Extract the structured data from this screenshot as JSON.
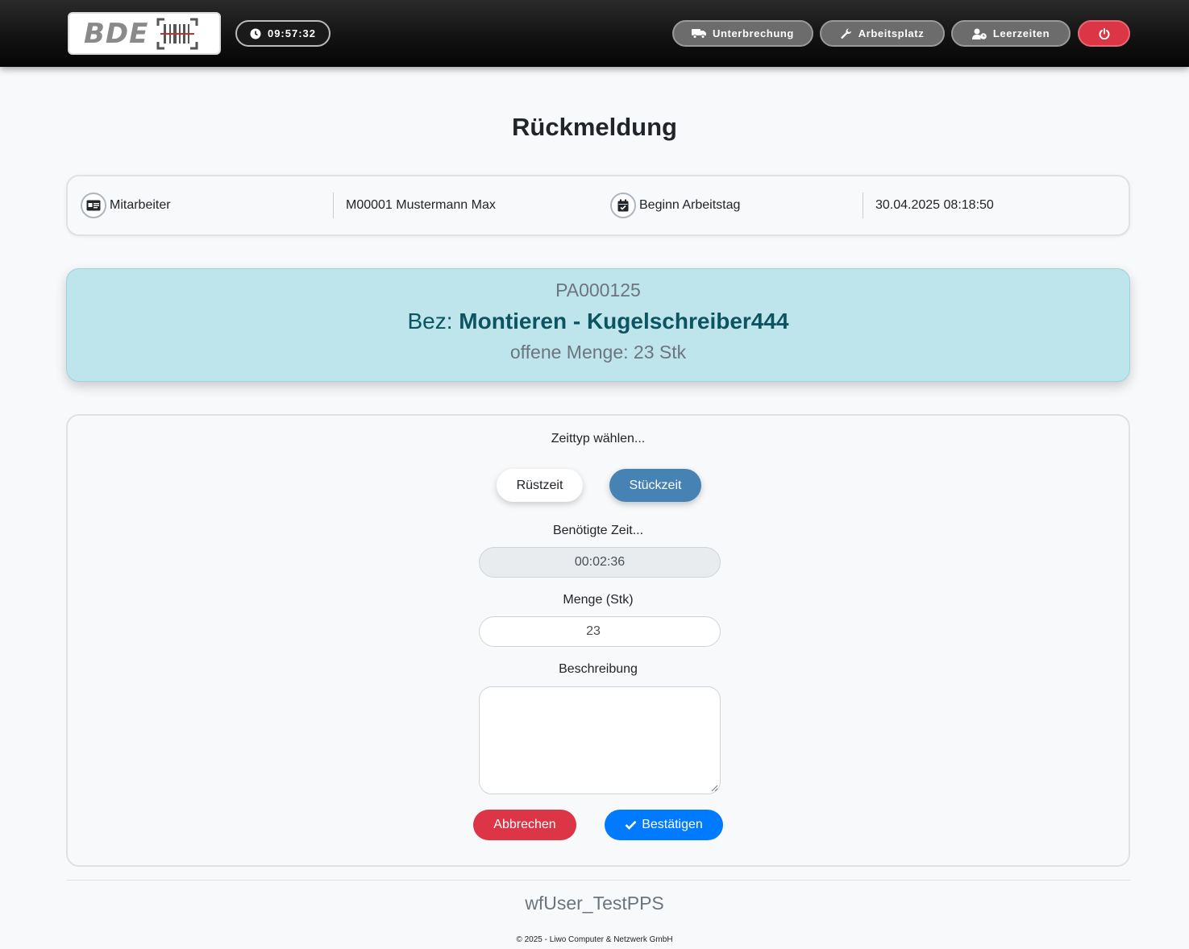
{
  "header": {
    "logo_text": "BDE",
    "clock": "09:57:32",
    "buttons": {
      "interruption": "Unterbrechung",
      "workplace": "Arbeitsplatz",
      "idle_times": "Leerzeiten"
    }
  },
  "page": {
    "title": "Rückmeldung"
  },
  "info": {
    "employee_label": "Mitarbeiter",
    "employee_value": "M00001 Mustermann Max",
    "workday_label": "Beginn Arbeitstag",
    "workday_value": "30.04.2025 08:18:50"
  },
  "order": {
    "number": "PA000125",
    "bez_prefix": "Bez:",
    "bez_value": "Montieren - Kugelschreiber444",
    "open_qty": "offene Menge: 23 Stk"
  },
  "form": {
    "time_type_label": "Zeittyp wählen...",
    "setup_time": "Rüstzeit",
    "piece_time": "Stückzeit",
    "required_time_label": "Benötigte Zeit...",
    "required_time_value": "00:02:36",
    "quantity_label": "Menge (Stk)",
    "quantity_value": "23",
    "description_label": "Beschreibung",
    "description_value": "",
    "cancel": "Abbrechen",
    "confirm": "Bestätigen"
  },
  "footer": {
    "user": "wfUser_TestPPS",
    "copyright": "© 2025 - Liwo Computer & Netzwerk GmbH"
  },
  "colors": {
    "accent_blue": "#007bff",
    "toggle_active": "#4682b4",
    "danger": "#dc3545",
    "order_bg": "#bee5eb"
  }
}
